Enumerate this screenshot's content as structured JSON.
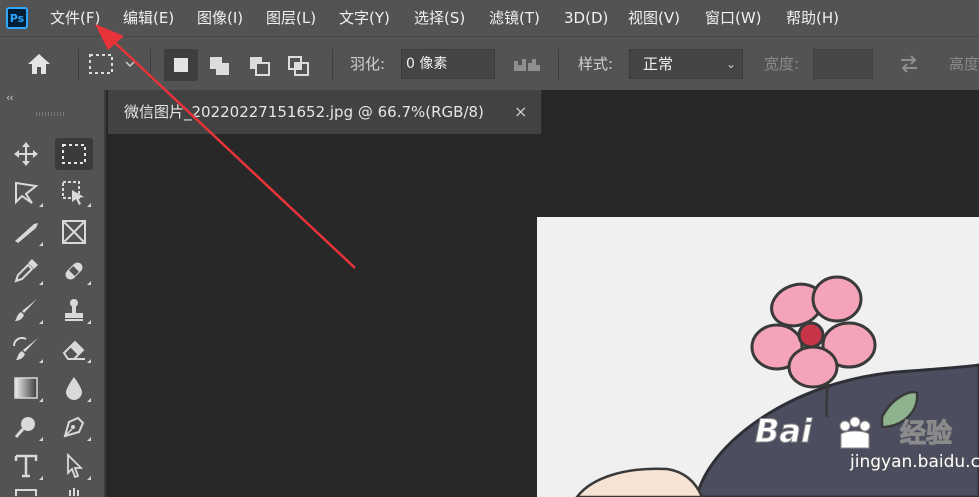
{
  "app": {
    "logo_text": "Ps"
  },
  "menu": {
    "items": [
      "文件(F)",
      "编辑(E)",
      "图像(I)",
      "图层(L)",
      "文字(Y)",
      "选择(S)",
      "滤镜(T)",
      "3D(D)",
      "视图(V)",
      "窗口(W)",
      "帮助(H)"
    ]
  },
  "options_bar": {
    "feather_label": "羽化:",
    "feather_value": "0 像素",
    "style_label": "样式:",
    "style_value": "正常",
    "width_label": "宽度:",
    "height_label": "高度"
  },
  "toolbar": {
    "collapse_label": "‹‹"
  },
  "document": {
    "tab_title": "微信图片_20220227151652.jpg @ 66.7%(RGB/8)",
    "close_glyph": "×"
  },
  "watermark": {
    "text": "jingyan.baidu.com"
  },
  "colors": {
    "accent": "#31a8ff",
    "annotation_arrow": "#e8333a",
    "panel": "#535353",
    "workspace": "#282828"
  }
}
